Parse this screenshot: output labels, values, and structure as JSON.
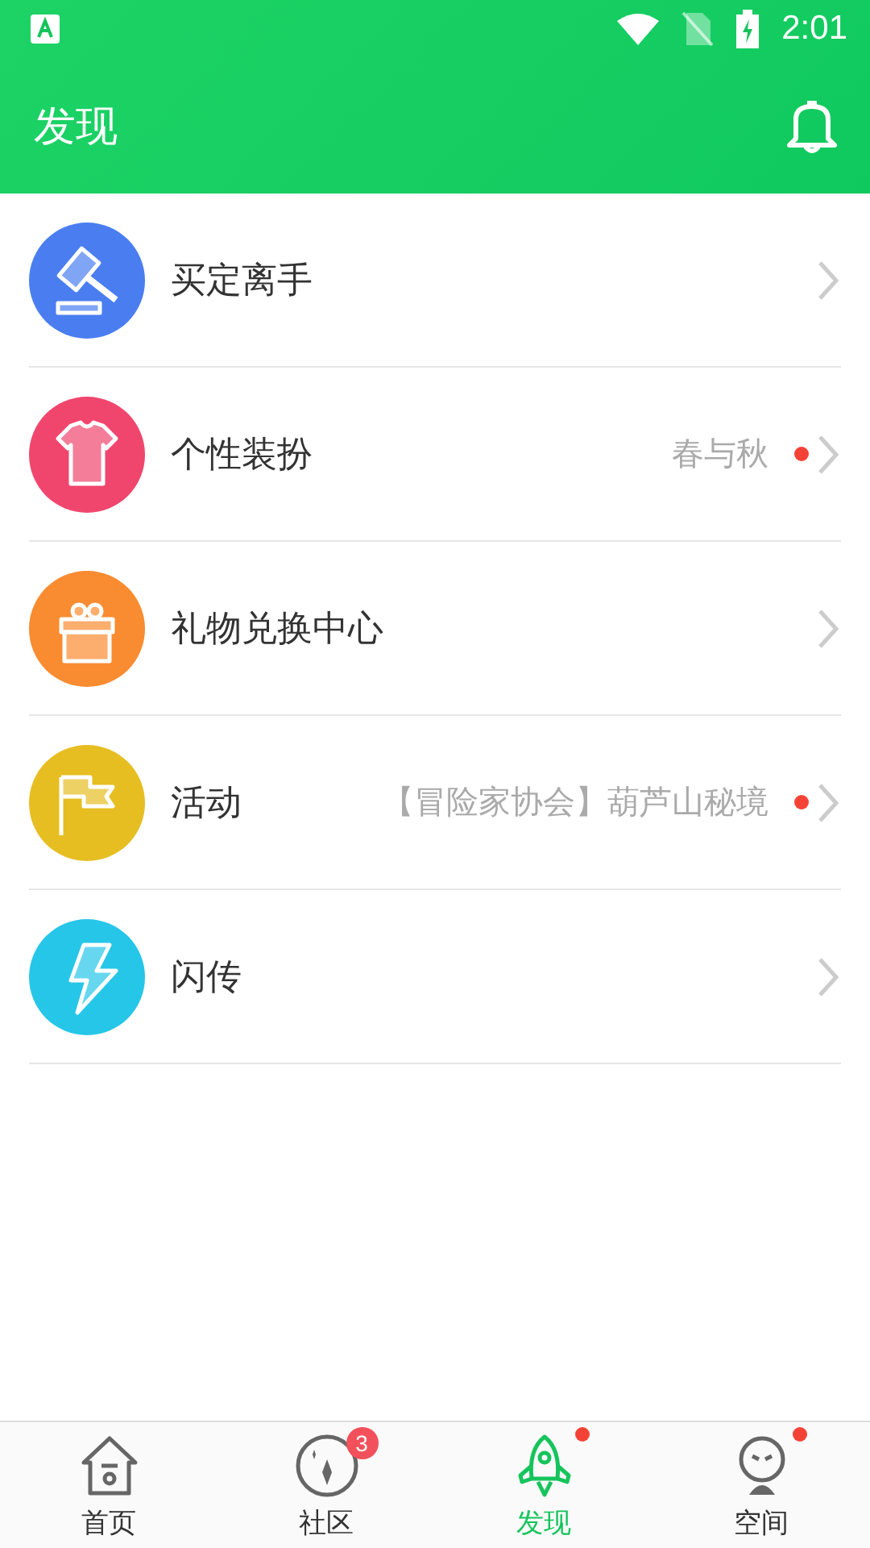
{
  "status_bar": {
    "time": "2:01"
  },
  "header": {
    "title": "发现"
  },
  "items": [
    {
      "kind": "gavel",
      "color": "#4a7ef0",
      "label": "买定离手",
      "dot": false
    },
    {
      "kind": "shirt",
      "color": "#f0466e",
      "label": "个性装扮",
      "detail": "春与秋",
      "dot": true
    },
    {
      "kind": "gift",
      "color": "#f98b30",
      "label": "礼物兑换中心",
      "dot": false
    },
    {
      "kind": "flag",
      "color": "#e6be22",
      "label": "活动",
      "detail": "【冒险家协会】葫芦山秘境",
      "dot": true
    },
    {
      "kind": "bolt",
      "color": "#26c6e8",
      "label": "闪传",
      "dot": false
    }
  ],
  "tabs": [
    {
      "kind": "home",
      "label": "首页",
      "selected": false,
      "dot": false
    },
    {
      "kind": "community",
      "label": "社区",
      "selected": false,
      "badge": "3",
      "dot": false
    },
    {
      "kind": "rocket",
      "label": "发现",
      "selected": true,
      "dot": true
    },
    {
      "kind": "space",
      "label": "空间",
      "selected": false,
      "dot": true
    }
  ]
}
